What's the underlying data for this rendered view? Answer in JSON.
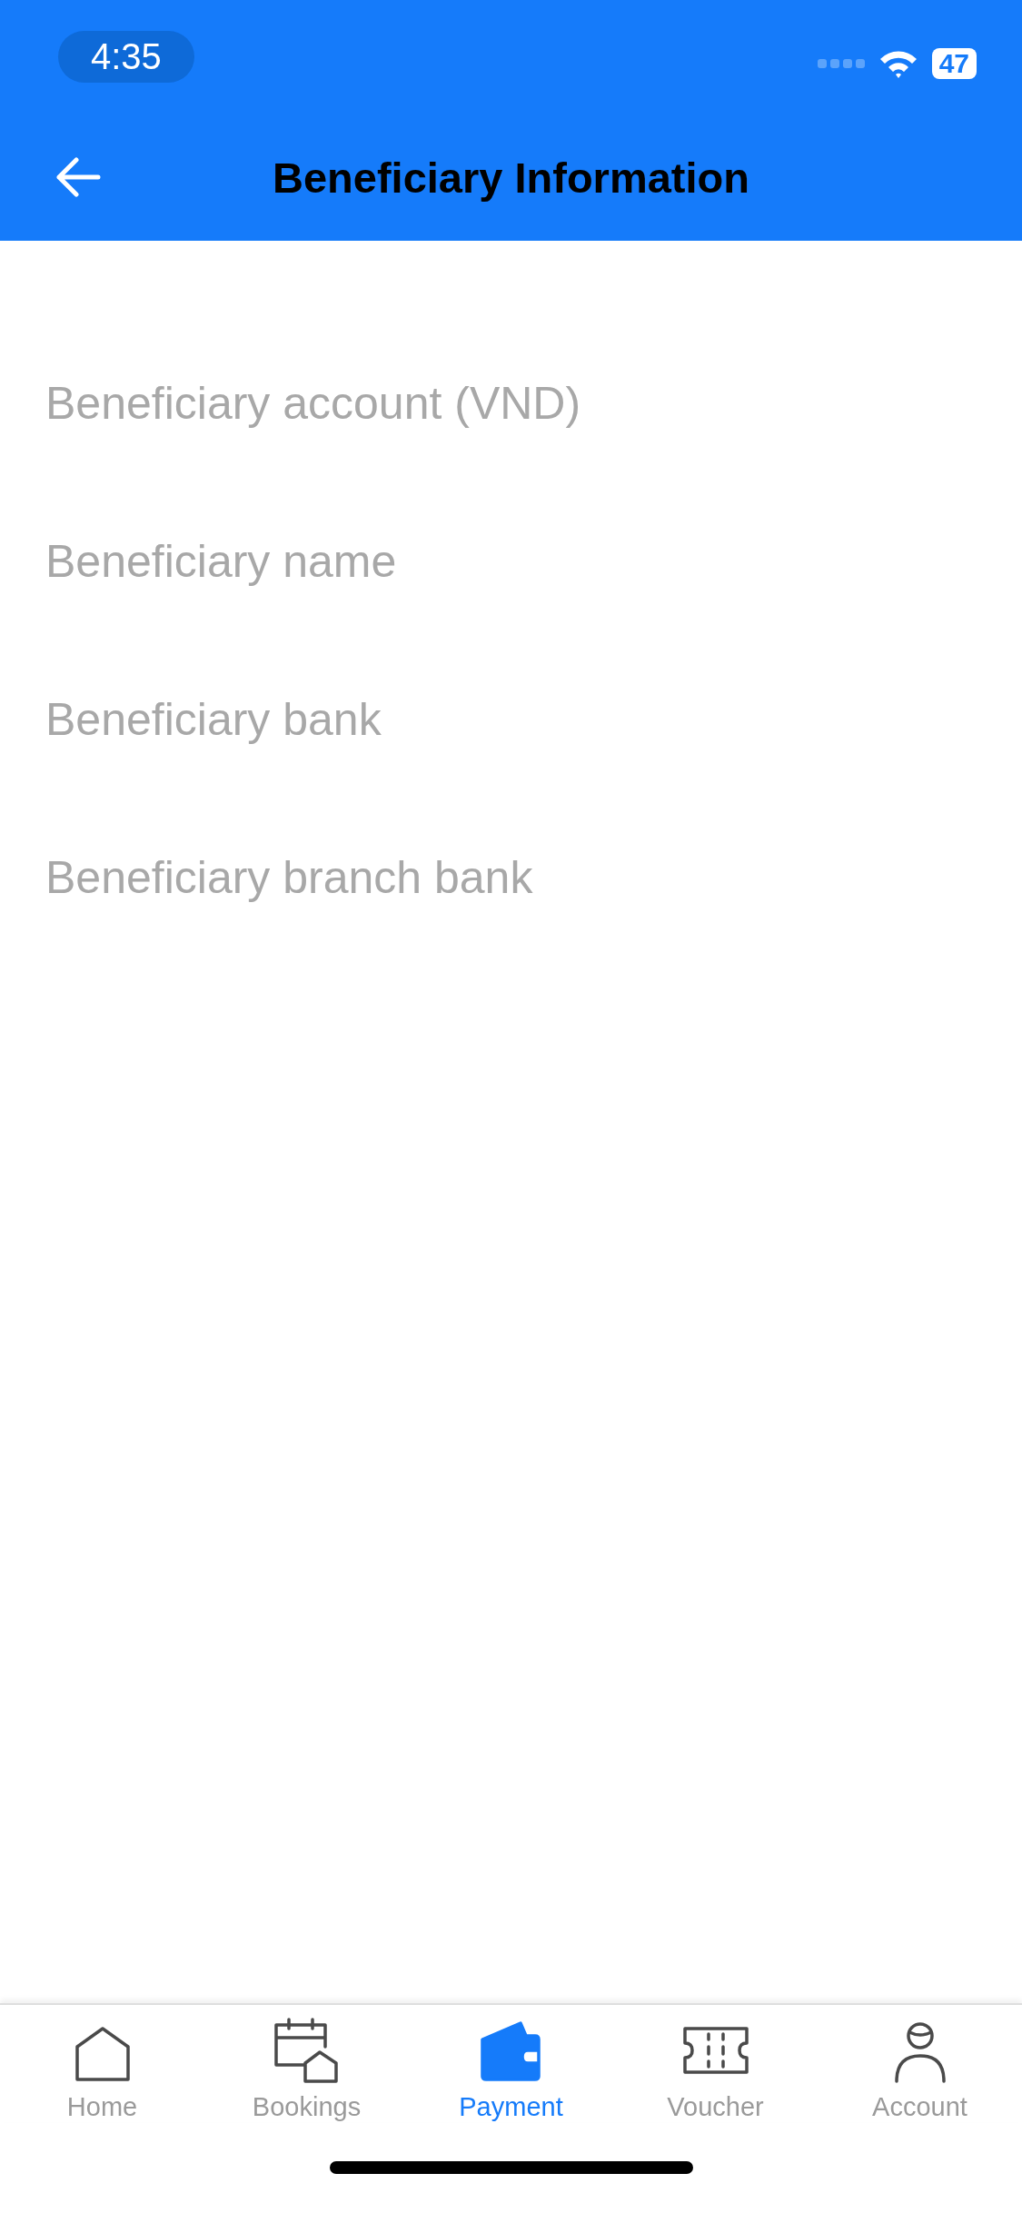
{
  "status_bar": {
    "time": "4:35",
    "battery": "47"
  },
  "header": {
    "title": "Beneficiary Information"
  },
  "fields": [
    {
      "placeholder": "Beneficiary account (VND)"
    },
    {
      "placeholder": "Beneficiary name"
    },
    {
      "placeholder": "Beneficiary bank"
    },
    {
      "placeholder": "Beneficiary branch bank"
    }
  ],
  "tab_bar": [
    {
      "kind": "home",
      "label": "Home",
      "selected": false
    },
    {
      "kind": "bookings",
      "label": "Bookings",
      "selected": false
    },
    {
      "kind": "payment",
      "label": "Payment",
      "selected": true
    },
    {
      "kind": "voucher",
      "label": "Voucher",
      "selected": false
    },
    {
      "kind": "account",
      "label": "Account",
      "selected": false
    }
  ]
}
